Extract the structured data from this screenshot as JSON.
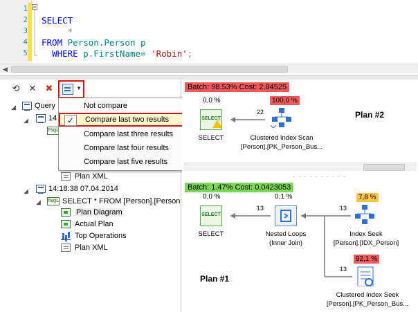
{
  "editor": {
    "line_numbers": [
      "1",
      "2",
      "3",
      "4",
      "5"
    ],
    "kw_select": "SELECT",
    "star": "*",
    "kw_from": "FROM",
    "table": "Person.Person",
    "alias": "p",
    "kw_where": "WHERE",
    "condition": "p.FirstName=",
    "value": "'Robin'",
    "terminator": ";"
  },
  "compare_menu": {
    "items": [
      "Not compare",
      "Compare last two results",
      "Compare last three results",
      "Compare last four results",
      "Compare last five results"
    ],
    "selected_index": 1,
    "check_glyph": "✓"
  },
  "tree": {
    "root": "Query",
    "node_partial_time": "14",
    "plan_xml_1": "Plan XML",
    "node2_time": "14:18:38 07.04.2014",
    "node2_query": "SELECT * FROM [Person].[Person",
    "items": [
      "Plan Diagram",
      "Actual Plan",
      "Top Operations",
      "Plan XML"
    ],
    "badge_sql": "TSQL"
  },
  "plan2": {
    "title": "Plan #2",
    "batch": "Batch: 98.53% Cost: 2.84525",
    "batch_color": "#f05a5a",
    "select_cost": "0,0 %",
    "select_label": "SELECT",
    "rows": "22",
    "scan_cost": "100,0 %",
    "scan_label_line1": "Clustered Index Scan",
    "scan_label_line2": "[Person].[PK_Person_Bus..."
  },
  "plan1": {
    "title": "Plan #1",
    "batch": "Batch: 1.47% Cost: 0.0423053",
    "batch_color": "#7dd657",
    "select_cost": "0,0 %",
    "select_label": "SELECT",
    "rows_select": "13",
    "loops_cost": "0,1 %",
    "loops_label_line1": "Nested Loops",
    "loops_label_line2": "(Inner Join)",
    "rows_seek": "13",
    "seek_cost": "7,8 %",
    "seek_label_line1": "Index Seek",
    "seek_label_line2": "[Person].[IDX_Person]",
    "rows_cseek": "13",
    "cseek_cost": "92,1 %",
    "cseek_label_line1": "Clustered Index Seek",
    "cseek_label_line2": "[Person].[PK_Person_Bus..."
  },
  "colors": {
    "highlight_border": "#d41414",
    "badge_red": "#f05a5a",
    "badge_orange": "#ffc24a",
    "badge_green": "#7dd657",
    "menu_selected": "#fff5cf"
  },
  "icons": {
    "refresh": "refresh-icon",
    "delete": "delete-icon",
    "clear": "clear-icon",
    "compare": "compare-icon"
  }
}
